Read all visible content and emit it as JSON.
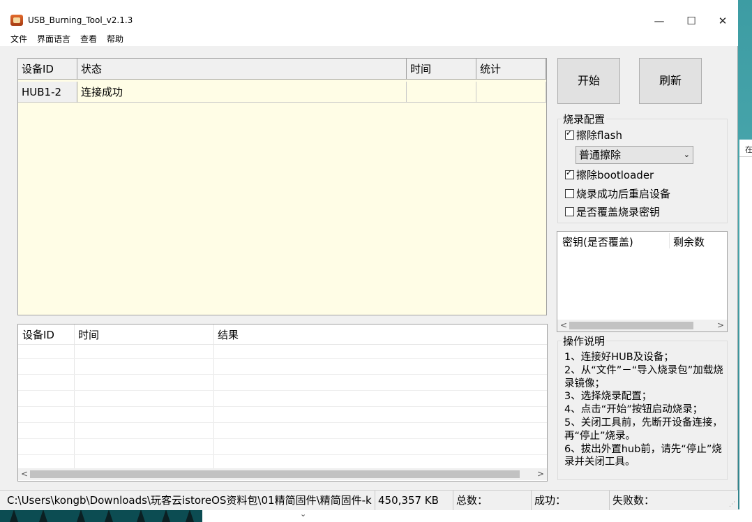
{
  "window": {
    "title": "USB_Burning_Tool_v2.1.3",
    "minimize": "—",
    "maximize": "☐",
    "close": "✕"
  },
  "menu": [
    "文件",
    "界面语言",
    "查看",
    "帮助"
  ],
  "device_table": {
    "headers": [
      "设备ID",
      "状态",
      "时间",
      "统计"
    ],
    "rows": [
      {
        "id": "HUB1-2",
        "status": "连接成功",
        "time": "",
        "stat": ""
      }
    ],
    "row_color": "#fffde6"
  },
  "log_table": {
    "headers": [
      "设备ID",
      "时间",
      "结果"
    ]
  },
  "buttons": {
    "start": "开始",
    "refresh": "刷新"
  },
  "burn_config": {
    "title": "烧录配置",
    "erase_flash": {
      "label": "擦除flash",
      "checked": true
    },
    "erase_mode": "普通擦除",
    "erase_bootloader": {
      "label": "擦除bootloader",
      "checked": true
    },
    "reboot_after": {
      "label": "烧录成功后重启设备",
      "checked": false
    },
    "overwrite_key": {
      "label": "是否覆盖烧录密钥",
      "checked": false
    }
  },
  "key_table": {
    "headers": [
      "密钥(是否覆盖)",
      "剩余数"
    ]
  },
  "instructions": {
    "title": "操作说明",
    "lines": [
      "1、连接好HUB及设备；",
      "2、从“文件”－“导入烧录包”加载烧录镜像；",
      "3、选择烧录配置；",
      "4、点击“开始”按钮启动烧录；",
      "5、关闭工具前，先断开设备连接，再“停止”烧录。",
      "6、拔出外置hub前，请先“停止”烧录并关闭工具。"
    ]
  },
  "status_bar": {
    "path": "C:\\Users\\kongb\\Downloads\\玩客云istoreOS资料包\\01精简固件\\精简固件-k",
    "size": "450,357 KB",
    "total": "总数：",
    "success": "成功：",
    "fail": "失败数："
  },
  "background": {
    "peek_text": "在"
  }
}
